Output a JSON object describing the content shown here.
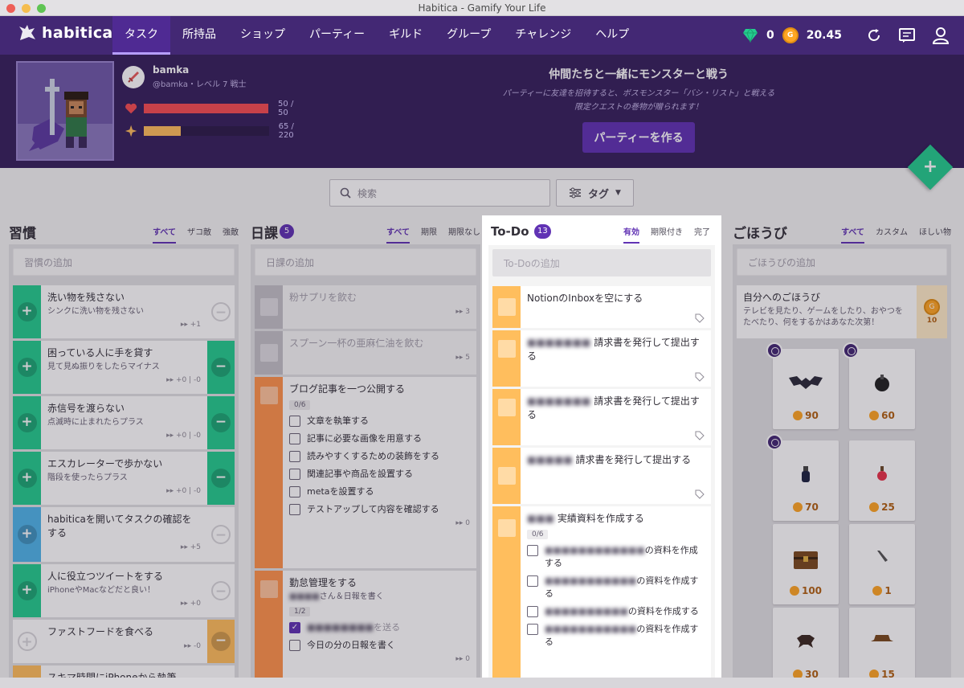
{
  "window": {
    "title": "Habitica - Gamify Your Life"
  },
  "nav": {
    "logo": "habitica",
    "items": [
      "タスク",
      "所持品",
      "ショップ",
      "パーティー",
      "ギルド",
      "グループ",
      "チャレンジ",
      "ヘルプ"
    ],
    "gems": "0",
    "gold": "20.45"
  },
  "hero": {
    "name": "bamka",
    "handle": "@bamka・レベル 7 戦士",
    "hp": {
      "text": "50 / 50",
      "fraction": 1.0
    },
    "xp": {
      "text": "65 / 220",
      "fraction": 0.295
    }
  },
  "party": {
    "title": "仲間たちと一緒にモンスターと戦う",
    "desc1": "パーティーに友達を招待すると、ボスモンスター「バシ・リスト」と戦える",
    "desc2": "限定クエストの巻物が贈られます！",
    "button": "パーティーを作る"
  },
  "toolbar": {
    "search_placeholder": "検索",
    "tags": "タグ"
  },
  "habits": {
    "title": "習慣",
    "filters": [
      "すべて",
      "ザコ敵",
      "強敵"
    ],
    "add": "習慣の追加",
    "items": [
      {
        "title": "洗い物を残さない",
        "note": "シンクに洗い物を残さない",
        "meta": "▸▸ +1"
      },
      {
        "title": "困っている人に手を貸す",
        "note": "見て見ぬ振りをしたらマイナス",
        "meta": "▸▸ +0 | -0"
      },
      {
        "title": "赤信号を渡らない",
        "note": "点滅時に止まれたらプラス",
        "meta": "▸▸ +0 | -0"
      },
      {
        "title": "エスカレーターで歩かない",
        "note": "階段を使ったらプラス",
        "meta": "▸▸ +0 | -0"
      },
      {
        "title": "habiticaを開いてタスクの確認をする",
        "note": "",
        "meta": "▸▸ +5"
      },
      {
        "title": "人に役立つツイートをする",
        "note": "iPhoneやMacなどだと良い！",
        "meta": "▸▸ +0"
      },
      {
        "title": "ファストフードを食べる",
        "note": "",
        "meta": "▸▸ -0"
      },
      {
        "title": "スキマ時間にiPhoneから執筆",
        "note": "",
        "meta": ""
      }
    ]
  },
  "dailies": {
    "title": "日課",
    "count": "5",
    "filters": [
      "すべて",
      "期限",
      "期限なし"
    ],
    "add": "日課の追加",
    "items": [
      {
        "title": "粉サプリを飲む",
        "meta": "▸▸ 3"
      },
      {
        "title": "スプーン一杯の亜麻仁油を飲む",
        "meta": "▸▸ 5"
      },
      {
        "title": "ブログ記事を一つ公開する",
        "checklist_count": "0/6",
        "checklist": [
          "文章を執筆する",
          "記事に必要な画像を用意する",
          "読みやすくするための装飾をする",
          "関連記事や商品を設置する",
          "metaを設置する",
          "テストアップして内容を確認する"
        ],
        "meta": "▸▸ 0"
      },
      {
        "title": "勤怠管理をする",
        "note_suffix": "さん＆日報を書く",
        "checklist_count": "1/2",
        "checklist_done_suffix": "を送る",
        "checklist2": "今日の分の日報を書く",
        "meta": "▸▸ 0"
      }
    ]
  },
  "todos": {
    "title": "To-Do",
    "count": "13",
    "filters": [
      "有効",
      "期限付き",
      "完了"
    ],
    "add": "To-Doの追加",
    "items": [
      {
        "title": "NotionのInboxを空にする"
      },
      {
        "prefix": "■■■■■■■",
        "title": "請求書を発行して提出する"
      },
      {
        "prefix": "■■■■■■■",
        "title": "請求書を発行して提出する"
      },
      {
        "prefix": "■■■■■",
        "title": "請求書を発行して提出する"
      },
      {
        "prefix": "■■■",
        "title": "実績資料を作成する",
        "checklist_count": "0/6",
        "checklist": [
          {
            "hidden": "■■■■■■■■■■■■",
            "text": "の資料を作成する"
          },
          {
            "hidden": "■■■■■■■■■■■",
            "text": "の資料を作成する"
          },
          {
            "hidden": "■■■■■■■■■■",
            "text": "の資料を作成する"
          },
          {
            "hidden": "■■■■■■■■■■■",
            "text": "の資料を作成する"
          }
        ]
      }
    ]
  },
  "rewards": {
    "title": "ごほうび",
    "filters": [
      "すべて",
      "カスタム",
      "ほしい物"
    ],
    "add": "ごほうびの追加",
    "custom": {
      "title": "自分へのごほうび",
      "note": "テレビを見たり、ゲームをしたり、おやつをたべたり、何をするかはあなた次第！",
      "price": "10"
    },
    "items": [
      {
        "price": "90",
        "icon": "bat-wing-icon",
        "limited": true
      },
      {
        "price": "60",
        "icon": "black-bomb-icon",
        "limited": true
      },
      {
        "price": "70",
        "icon": "dark-potion-icon",
        "limited": true
      },
      {
        "price": "25",
        "icon": "red-potion-icon",
        "limited": false
      },
      {
        "price": "100",
        "icon": "treasure-chest-icon",
        "limited": false
      },
      {
        "price": "1",
        "icon": "pencil-icon",
        "limited": false
      },
      {
        "price": "30",
        "icon": "dark-helmet-icon",
        "limited": false
      },
      {
        "price": "15",
        "icon": "brown-hat-icon",
        "limited": false
      }
    ]
  },
  "colors": {
    "nav": "#432874",
    "header": "#36205d",
    "accent": "#6133b4",
    "green": "#24cc8f",
    "orange": "#ff944c",
    "yellow": "#ffbe5d",
    "teal": "#50b5e9",
    "gold": "#ffa624"
  }
}
